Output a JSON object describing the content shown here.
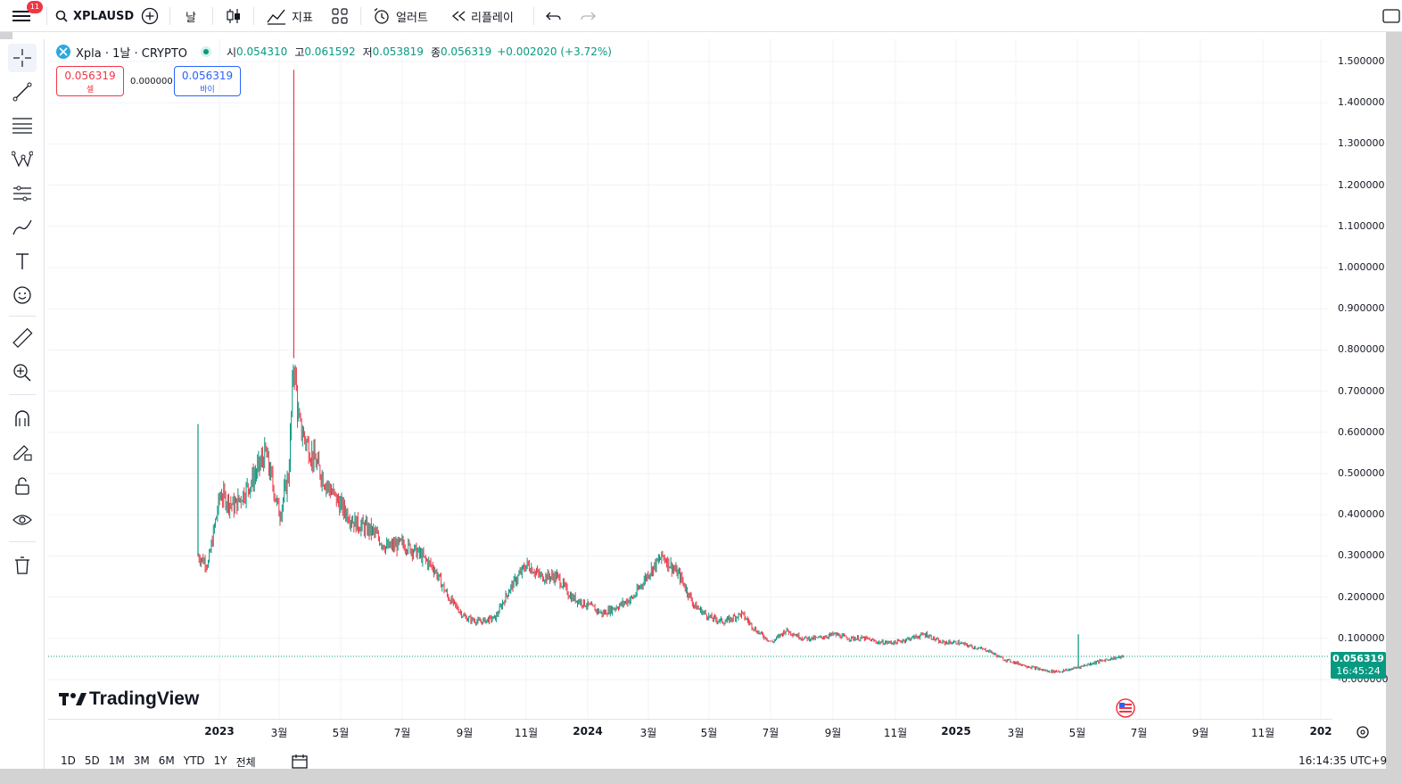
{
  "topbar": {
    "notification_count": "11",
    "symbol": "XPLAUSD",
    "interval": "날",
    "indicators_label": "지표",
    "alert_label": "얼러트",
    "replay_label": "리플레이"
  },
  "legend": {
    "title": "Xpla · 1날 · CRYPTO",
    "open_label": "시",
    "open": "0.054310",
    "high_label": "고",
    "high": "0.061592",
    "low_label": "저",
    "low": "0.053819",
    "close_label": "종",
    "close": "0.056319",
    "change": "+0.002020 (+3.72%)"
  },
  "trade": {
    "sell_price": "0.056319",
    "sell_label": "셀",
    "spread": "0.000000",
    "buy_price": "0.056319",
    "buy_label": "바이"
  },
  "price_axis": [
    "1.500000",
    "1.400000",
    "1.300000",
    "1.200000",
    "1.100000",
    "1.000000",
    "0.900000",
    "0.800000",
    "0.700000",
    "0.600000",
    "0.500000",
    "0.400000",
    "0.300000",
    "0.200000",
    "0.100000",
    "-0.000000"
  ],
  "current_price": {
    "value": "0.056319",
    "countdown": "16:45:24"
  },
  "time_axis": [
    "2023",
    "3월",
    "5월",
    "7월",
    "9월",
    "11월",
    "2024",
    "3월",
    "5월",
    "7월",
    "9월",
    "11월",
    "2025",
    "3월",
    "5월",
    "7월",
    "9월",
    "11월",
    "202"
  ],
  "ranges": [
    "1D",
    "5D",
    "1M",
    "3M",
    "6M",
    "YTD",
    "1Y",
    "전체"
  ],
  "clock": "16:14:35 UTC+9",
  "logo_text": "TradingView",
  "colors": {
    "up": "#089981",
    "down": "#f23645",
    "accent": "#2962ff"
  },
  "chart_data": {
    "type": "candlestick-line",
    "x": [
      "2022-12-10",
      "2022-12-20",
      "2023-01-01",
      "2023-01-15",
      "2023-02-01",
      "2023-02-15",
      "2023-03-01",
      "2023-03-10",
      "2023-03-15",
      "2023-03-20",
      "2023-04-01",
      "2023-04-15",
      "2023-05-01",
      "2023-05-15",
      "2023-06-01",
      "2023-06-15",
      "2023-07-01",
      "2023-07-15",
      "2023-08-01",
      "2023-08-15",
      "2023-09-01",
      "2023-09-15",
      "2023-10-01",
      "2023-10-15",
      "2023-11-01",
      "2023-11-15",
      "2023-12-01",
      "2023-12-15",
      "2024-01-01",
      "2024-01-15",
      "2024-02-01",
      "2024-02-15",
      "2024-03-01",
      "2024-03-15",
      "2024-04-01",
      "2024-04-15",
      "2024-05-01",
      "2024-05-15",
      "2024-06-01",
      "2024-06-15",
      "2024-07-01",
      "2024-07-15",
      "2024-08-01",
      "2024-08-15",
      "2024-09-01",
      "2024-09-15",
      "2024-10-01",
      "2024-10-15",
      "2024-11-01",
      "2024-11-15",
      "2024-12-01",
      "2024-12-15",
      "2025-01-01",
      "2025-01-15",
      "2025-02-01",
      "2025-02-15",
      "2025-03-01",
      "2025-03-15",
      "2025-04-01",
      "2025-04-15",
      "2025-05-01",
      "2025-05-15",
      "2025-06-01",
      "2025-06-15"
    ],
    "y": [
      0.3,
      0.28,
      0.45,
      0.42,
      0.48,
      0.55,
      0.4,
      0.5,
      0.78,
      0.62,
      0.55,
      0.48,
      0.42,
      0.38,
      0.36,
      0.32,
      0.33,
      0.31,
      0.27,
      0.2,
      0.15,
      0.14,
      0.15,
      0.22,
      0.28,
      0.25,
      0.25,
      0.2,
      0.18,
      0.16,
      0.18,
      0.2,
      0.26,
      0.3,
      0.25,
      0.18,
      0.15,
      0.14,
      0.16,
      0.12,
      0.09,
      0.12,
      0.1,
      0.1,
      0.11,
      0.1,
      0.1,
      0.09,
      0.09,
      0.1,
      0.11,
      0.09,
      0.09,
      0.08,
      0.07,
      0.05,
      0.04,
      0.03,
      0.02,
      0.02,
      0.03,
      0.04,
      0.05,
      0.056
    ],
    "spikes": [
      {
        "x": "2022-12-10",
        "high": 0.62
      },
      {
        "x": "2023-03-15",
        "high": 1.48
      },
      {
        "x": "2025-05-01",
        "high": 0.11
      }
    ],
    "ylim": [
      -0.05,
      1.55
    ]
  }
}
